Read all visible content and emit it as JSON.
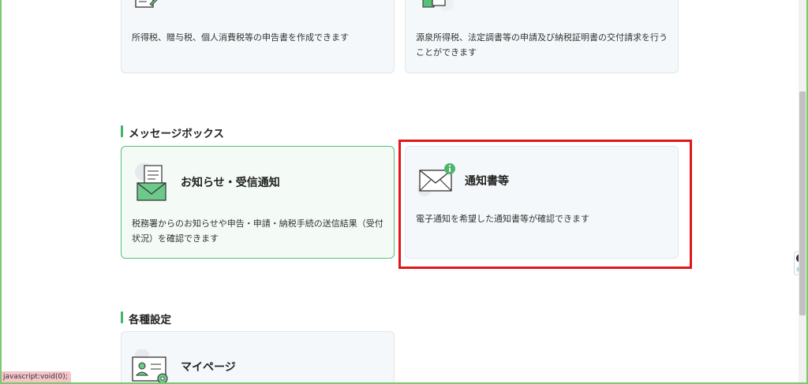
{
  "cards_top": {
    "income_tax": {
      "description": "所得税、贈与税、個人消費税等の申告書を作成できます"
    },
    "withholding": {
      "description_line1": "源泉所得税、法定調書等の申請及び納税証明書の交付請求を行う",
      "description_line2": "ことができます"
    }
  },
  "message_box": {
    "heading": "メッセージボックス",
    "notices": {
      "title": "お知らせ・受信通知",
      "description_line1": "税務署からのお知らせや申告・申請・納税手続の送信結果（受付",
      "description_line2": "状況）を確認できます"
    },
    "notification_docs": {
      "title": "通知書等",
      "description": "電子通知を希望した通知書等が確認できます"
    }
  },
  "settings": {
    "heading": "各種設定",
    "mypage": {
      "title": "マイページ"
    }
  },
  "status_bar": {
    "url": "javascript:void(0);"
  },
  "colors": {
    "accent_green": "#3fb56a",
    "highlight_red": "#e1161b"
  },
  "icons": [
    "document-pen-icon",
    "document-hand-icon",
    "mail-document-icon",
    "envelope-info-icon",
    "profile-card-gear-icon",
    "close-icon",
    "chat-icon"
  ]
}
